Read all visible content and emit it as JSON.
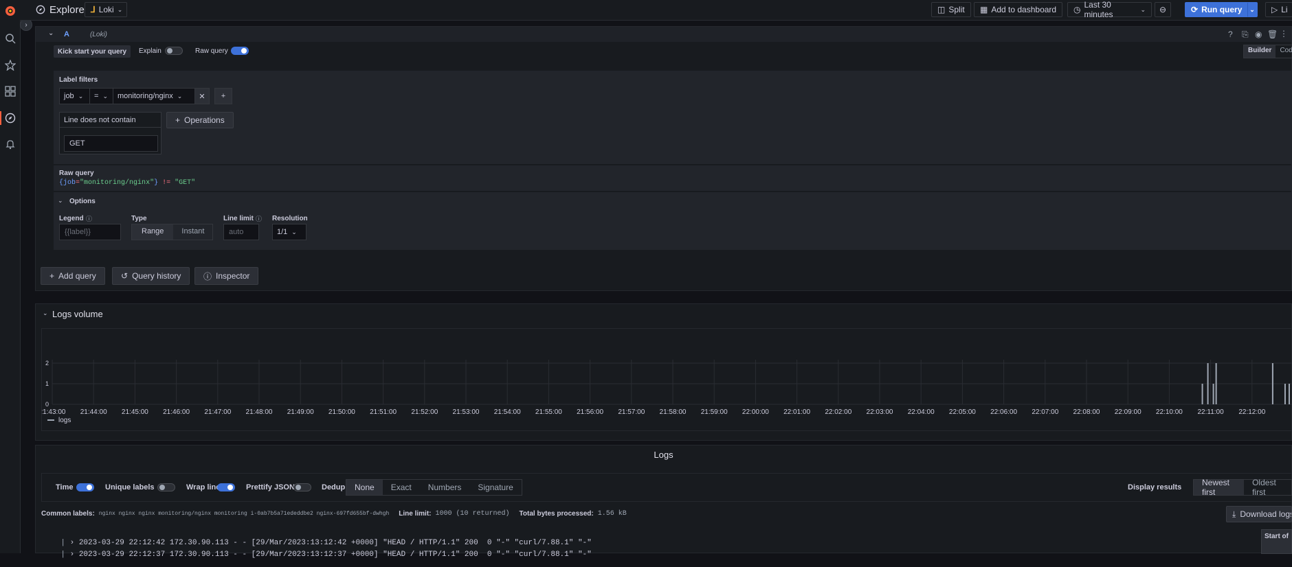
{
  "topbar": {
    "title": "Explore",
    "datasource": "Loki",
    "split_label": "Split",
    "add_dashboard_label": "Add to dashboard",
    "time_range": "Last 30 minutes",
    "run_query_label": "Run query",
    "live_label": "Li"
  },
  "query": {
    "letter": "A",
    "datasource": "(Loki)",
    "kick_start": "Kick start your query",
    "explain_label": "Explain",
    "raw_query_label": "Raw query",
    "mode_builder": "Builder",
    "mode_code": "Code",
    "label_filters_title": "Label filters",
    "filter_label": "job",
    "filter_op": "=",
    "filter_value": "monitoring/nginx",
    "operation_title": "Line does not contain",
    "operation_value": "GET",
    "operations_label": "Operations",
    "raw_query_title": "Raw query",
    "raw_query_parts": [
      "{",
      "job",
      "=",
      "\"monitoring/nginx\"",
      "}",
      " != ",
      "\"GET\""
    ],
    "options_title": "Options",
    "legend_label": "Legend",
    "legend_placeholder": "{{label}}",
    "type_label": "Type",
    "type_range": "Range",
    "type_instant": "Instant",
    "line_limit_label": "Line limit",
    "line_limit_placeholder": "auto",
    "resolution_label": "Resolution",
    "resolution_value": "1/1"
  },
  "actions": {
    "add_query": "Add query",
    "query_history": "Query history",
    "inspector": "Inspector"
  },
  "volume": {
    "title": "Logs volume",
    "legend": "logs"
  },
  "chart_data": {
    "type": "bar",
    "title": "",
    "y_ticks": [
      "0",
      "1",
      "2"
    ],
    "ylim": [
      0,
      2
    ],
    "x_ticks": [
      "21:43:00",
      "21:44:00",
      "21:45:00",
      "21:46:00",
      "21:47:00",
      "21:48:00",
      "21:49:00",
      "21:50:00",
      "21:51:00",
      "21:52:00",
      "21:53:00",
      "21:54:00",
      "21:55:00",
      "21:56:00",
      "21:57:00",
      "21:58:00",
      "21:59:00",
      "22:00:00",
      "22:01:00",
      "22:02:00",
      "22:03:00",
      "22:04:00",
      "22:05:00",
      "22:06:00",
      "22:07:00",
      "22:08:00",
      "22:09:00",
      "22:10:00",
      "22:11:00",
      "22:12:00"
    ],
    "series": [
      {
        "name": "logs",
        "color": "#9fa7b3",
        "points": [
          {
            "t": "22:10:48",
            "v": 1
          },
          {
            "t": "22:10:56",
            "v": 2
          },
          {
            "t": "22:11:04",
            "v": 1
          },
          {
            "t": "22:11:08",
            "v": 2
          },
          {
            "t": "22:12:30",
            "v": 2
          },
          {
            "t": "22:12:48",
            "v": 1
          },
          {
            "t": "22:12:54",
            "v": 1
          }
        ]
      }
    ]
  },
  "logs": {
    "title": "Logs",
    "time_label": "Time",
    "unique_labels_label": "Unique labels",
    "wrap_lines_label": "Wrap lines",
    "prettify_label": "Prettify JSON",
    "dedup_label": "Dedup",
    "dedup_options": [
      "None",
      "Exact",
      "Numbers",
      "Signature"
    ],
    "display_results_label": "Display results",
    "order_options": [
      "Newest first",
      "Oldest first"
    ],
    "common_labels_title": "Common labels:",
    "common_labels": "nginx nginx nginx monitoring/nginx monitoring i-0ab7b5a71ededdbe2 nginx-697fd655bf-dwhgh",
    "line_limit_title": "Line limit:",
    "line_limit_value": "1000 (10 returned)",
    "bytes_title": "Total bytes processed:",
    "bytes_value": "1.56 kB",
    "download_label": "Download logs",
    "start_label": "Start of",
    "lines": [
      "2023-03-29 22:12:42 172.30.90.113 - - [29/Mar/2023:13:12:42 +0000] \"HEAD / HTTP/1.1\" 200  0 \"-\" \"curl/7.88.1\" \"-\"",
      "2023-03-29 22:12:37 172.30.90.113 - - [29/Mar/2023:13:12:37 +0000] \"HEAD / HTTP/1.1\" 200  0 \"-\" \"curl/7.88.1\" \"-\""
    ]
  },
  "colors": {
    "accent": "#3d71d9",
    "brand": "#f55f3e",
    "bg": "#111217",
    "panel": "#181b1f"
  }
}
